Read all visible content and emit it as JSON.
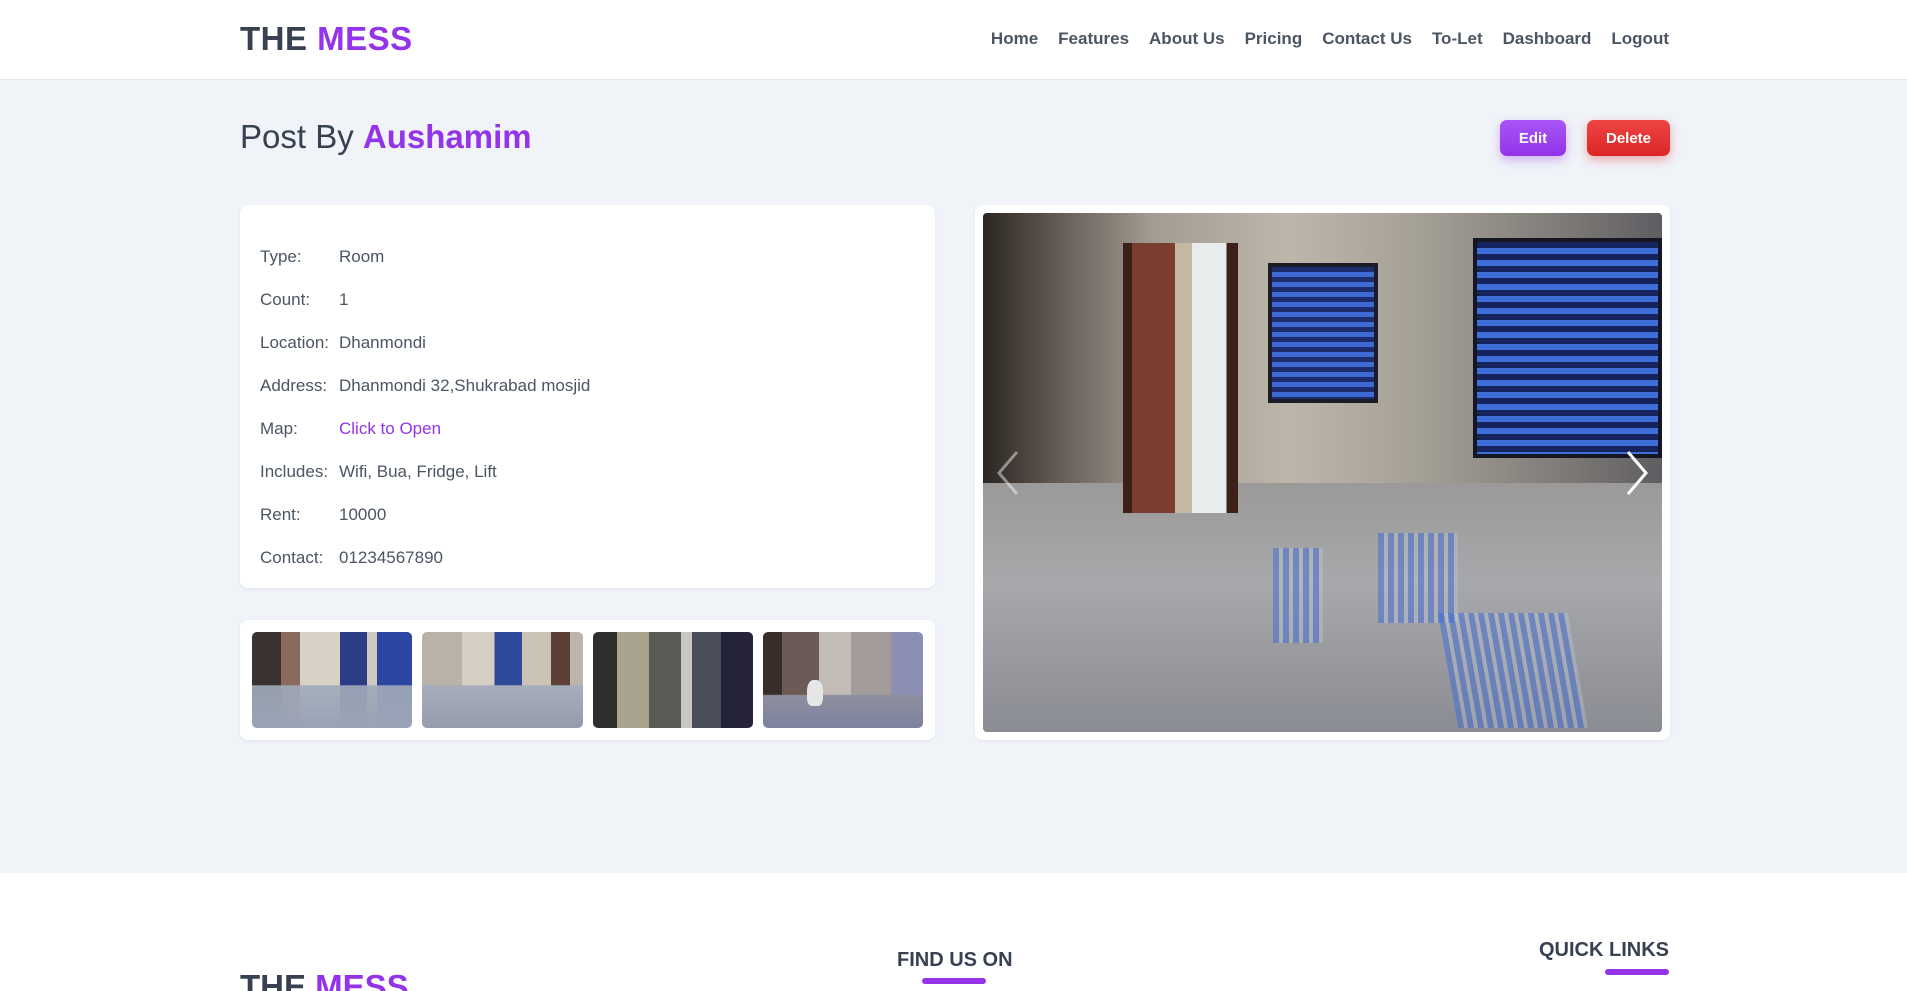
{
  "brand": {
    "part1": "THE",
    "part2": "MESS"
  },
  "nav": {
    "items": [
      "Home",
      "Features",
      "About Us",
      "Pricing",
      "Contact Us",
      "To-Let",
      "Dashboard",
      "Logout"
    ]
  },
  "page": {
    "title_prefix": "Post By",
    "author": "Aushamim",
    "edit_label": "Edit",
    "delete_label": "Delete"
  },
  "details": [
    {
      "label": "Type:",
      "value": "Room"
    },
    {
      "label": "Count:",
      "value": "1"
    },
    {
      "label": "Location:",
      "value": "Dhanmondi"
    },
    {
      "label": "Address:",
      "value": "Dhanmondi 32,Shukrabad mosjid"
    },
    {
      "label": "Map:",
      "value": "Click to Open"
    },
    {
      "label": "Includes:",
      "value": "Wifi, Bua, Fridge, Lift"
    },
    {
      "label": "Rent:",
      "value": "10000"
    },
    {
      "label": "Contact:",
      "value": "01234567890"
    }
  ],
  "footer": {
    "brand_part1": "THE",
    "brand_part2": "MESS",
    "find_us_heading": "FIND US ON",
    "quick_links_heading": "QUICK LINKS"
  },
  "colors": {
    "accent": "#9333ea",
    "danger": "#dc2626"
  }
}
